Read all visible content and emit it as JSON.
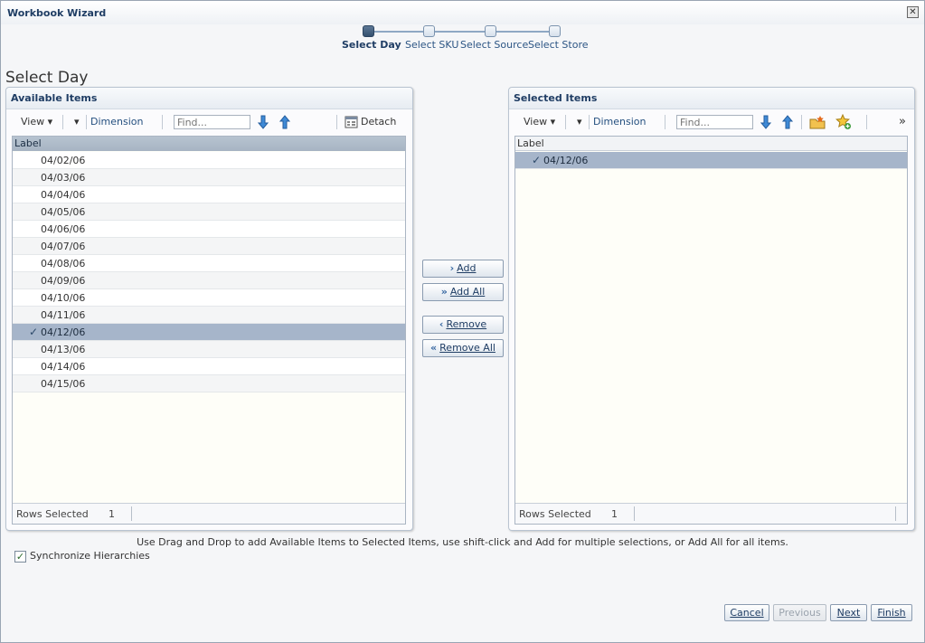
{
  "window": {
    "title": "Workbook Wizard"
  },
  "steps": [
    {
      "label": "Select Day",
      "active": true
    },
    {
      "label": "Select SKU",
      "active": false
    },
    {
      "label": "Select Source",
      "active": false
    },
    {
      "label": "Select Store",
      "active": false
    }
  ],
  "page_title": "Select Day",
  "available": {
    "title": "Available Items",
    "toolbar": {
      "view": "View",
      "dimension": "Dimension",
      "find_placeholder": "Find...",
      "detach": "Detach"
    },
    "column": "Label",
    "rows": [
      "04/02/06",
      "04/03/06",
      "04/04/06",
      "04/05/06",
      "04/06/06",
      "04/07/06",
      "04/08/06",
      "04/09/06",
      "04/10/06",
      "04/11/06",
      "04/12/06",
      "04/13/06",
      "04/14/06",
      "04/15/06"
    ],
    "selected_index": 10,
    "footer": {
      "label": "Rows Selected",
      "count": "1"
    }
  },
  "selected": {
    "title": "Selected Items",
    "toolbar": {
      "view": "View",
      "dimension": "Dimension",
      "find_placeholder": "Find...",
      "more": "»"
    },
    "column": "Label",
    "rows": [
      "04/12/06"
    ],
    "footer": {
      "label": "Rows Selected",
      "count": "1"
    }
  },
  "shuttle": {
    "add": "Add",
    "add_all": "Add All",
    "remove": "Remove",
    "remove_all": "Remove All"
  },
  "hint": "Use Drag and Drop to add Available Items to Selected Items, use shift-click and Add for multiple selections, or Add All for all items.",
  "sync": {
    "label": "Synchronize Hierarchies",
    "checked": true
  },
  "footer_buttons": {
    "cancel": "Cancel",
    "previous": "Previous",
    "next": "Next",
    "finish": "Finish"
  },
  "colors": {
    "accent": "#1f3d64",
    "selection": "#a6b5ca",
    "link": "#244f7f"
  }
}
